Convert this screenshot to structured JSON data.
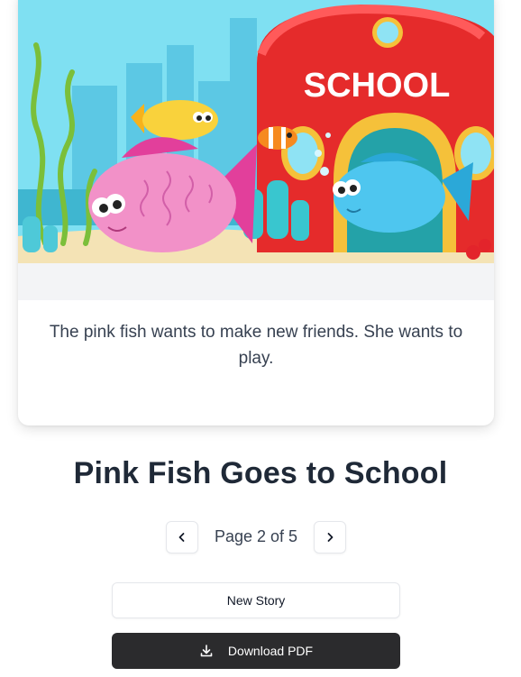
{
  "story": {
    "page_text": "The pink fish wants to make new friends. She wants to play.",
    "illustration_sign": "SCHOOL"
  },
  "title": "Pink Fish Goes to School",
  "pagination": {
    "label": "Page 2 of 5",
    "current": 2,
    "total": 5,
    "prev_icon": "chevron-left-icon",
    "next_icon": "chevron-right-icon"
  },
  "actions": {
    "new_story_label": "New Story",
    "download_label": "Download PDF",
    "download_icon": "download-icon"
  },
  "colors": {
    "dark_button": "#2b2b2d",
    "title_text": "#1f2937",
    "card_strip": "#f3f4f6"
  }
}
